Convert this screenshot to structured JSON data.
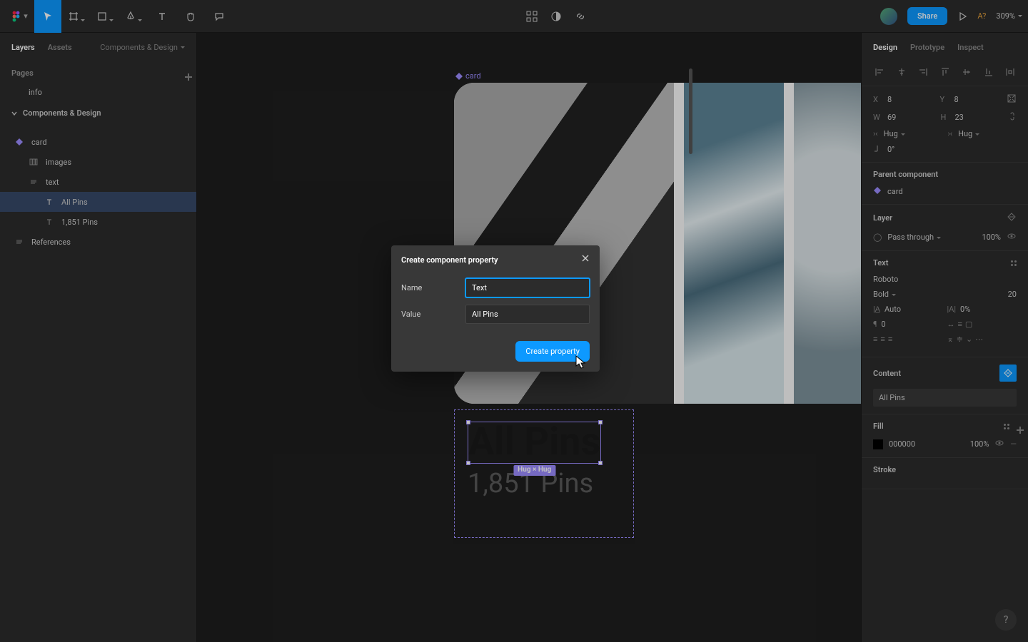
{
  "toolbar": {
    "share_label": "Share",
    "zoom": "309%",
    "dev_label": "A?"
  },
  "left": {
    "tabs": {
      "layers": "Layers",
      "assets": "Assets",
      "file": "Components & Design"
    },
    "pages_label": "Pages",
    "page_info": "info",
    "section_components": "Components & Design",
    "layers": {
      "card": "card",
      "images": "images",
      "text": "text",
      "all_pins": "All Pins",
      "count_pins": "1,851 Pins",
      "references": "References"
    }
  },
  "canvas": {
    "component_label": "card",
    "title": "All Pins",
    "subtitle": "1,851 Pins",
    "hug_label": "Hug × Hug"
  },
  "modal": {
    "title": "Create component property",
    "name_label": "Name",
    "name_value": "Text",
    "value_label": "Value",
    "value_value": "All Pins",
    "button": "Create property"
  },
  "right": {
    "tabs": {
      "design": "Design",
      "prototype": "Prototype",
      "inspect": "Inspect"
    },
    "pos": {
      "x_label": "X",
      "x": "8",
      "y_label": "Y",
      "y": "8",
      "w_label": "W",
      "w": "69",
      "h_label": "H",
      "h": "23",
      "hug": "Hug",
      "rot": "0°"
    },
    "parent_label": "Parent component",
    "parent_name": "card",
    "layer_label": "Layer",
    "blend": "Pass through",
    "opacity": "100%",
    "text_label": "Text",
    "font": "Roboto",
    "weight": "Bold",
    "size": "20",
    "line": "Auto",
    "letter": "0%",
    "para": "0",
    "content_label": "Content",
    "content_value": "All Pins",
    "fill_label": "Fill",
    "fill_hex": "000000",
    "fill_opacity": "100%",
    "stroke_label": "Stroke"
  }
}
